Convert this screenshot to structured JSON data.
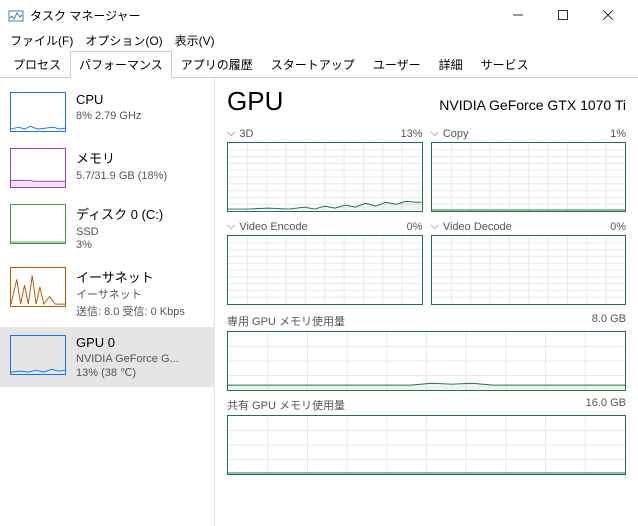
{
  "window": {
    "title": "タスク マネージャー"
  },
  "menu": {
    "file": "ファイル(F)",
    "options": "オプション(O)",
    "view": "表示(V)"
  },
  "tabs": {
    "processes": "プロセス",
    "performance": "パフォーマンス",
    "appHistory": "アプリの履歴",
    "startup": "スタートアップ",
    "users": "ユーザー",
    "details": "詳細",
    "services": "サービス"
  },
  "sidebar": {
    "cpu": {
      "title": "CPU",
      "line1": "8%  2.79 GHz"
    },
    "memory": {
      "title": "メモリ",
      "line1": "5.7/31.9 GB (18%)"
    },
    "disk": {
      "title": "ディスク 0 (C:)",
      "line1": "SSD",
      "line2": "3%"
    },
    "ethernet": {
      "title": "イーサネット",
      "line1": "イーサネット",
      "line2": "送信: 8.0 受信: 0 Kbps"
    },
    "gpu": {
      "title": "GPU 0",
      "line1": "NVIDIA GeForce G...",
      "line2": "13%  (38 ℃)"
    }
  },
  "main": {
    "heading": "GPU",
    "model": "NVIDIA GeForce GTX 1070 Ti",
    "charts": {
      "c3d": {
        "name": "3D",
        "value": "13%"
      },
      "copy": {
        "name": "Copy",
        "value": "1%"
      },
      "vencode": {
        "name": "Video Encode",
        "value": "0%"
      },
      "vdecode": {
        "name": "Video Decode",
        "value": "0%"
      }
    },
    "dedicated": {
      "label": "専用 GPU メモリ使用量",
      "max": "8.0 GB"
    },
    "shared": {
      "label": "共有 GPU メモリ使用量",
      "max": "16.0 GB"
    }
  },
  "chart_data": [
    {
      "type": "line",
      "title": "3D",
      "ylim": [
        0,
        100
      ],
      "values": [
        2,
        2,
        2,
        3,
        2,
        4,
        3,
        5,
        3,
        6,
        4,
        3,
        5,
        4,
        8,
        5,
        10,
        6,
        9,
        12,
        8,
        10,
        9,
        11,
        13
      ]
    },
    {
      "type": "line",
      "title": "Copy",
      "ylim": [
        0,
        100
      ],
      "values": [
        0,
        0,
        0,
        0,
        0,
        0,
        0,
        0,
        0,
        0,
        0,
        0,
        0,
        0,
        0,
        0,
        0,
        0,
        0,
        0,
        0,
        0,
        0,
        0,
        1
      ]
    },
    {
      "type": "line",
      "title": "Video Encode",
      "ylim": [
        0,
        100
      ],
      "values": [
        0,
        0,
        0,
        0,
        0,
        0,
        0,
        0,
        0,
        0,
        0,
        0,
        0,
        0,
        0,
        0,
        0,
        0,
        0,
        0,
        0,
        0,
        0,
        0,
        0
      ]
    },
    {
      "type": "line",
      "title": "Video Decode",
      "ylim": [
        0,
        100
      ],
      "values": [
        0,
        0,
        0,
        0,
        0,
        0,
        0,
        0,
        0,
        0,
        0,
        0,
        0,
        0,
        0,
        0,
        0,
        0,
        0,
        0,
        0,
        0,
        0,
        0,
        0
      ]
    },
    {
      "type": "line",
      "title": "専用 GPU メモリ使用量",
      "ylim": [
        0,
        8.0
      ],
      "values": [
        0.7,
        0.7,
        0.7,
        0.7,
        0.7,
        0.7,
        0.7,
        0.7,
        0.7,
        0.7,
        0.7,
        0.7,
        0.7,
        0.8,
        0.9,
        0.8,
        0.8,
        0.7,
        0.7,
        0.7,
        0.7,
        0.7,
        0.7,
        0.7,
        0.7
      ]
    },
    {
      "type": "line",
      "title": "共有 GPU メモリ使用量",
      "ylim": [
        0,
        16.0
      ],
      "values": [
        0.1,
        0.1,
        0.1,
        0.1,
        0.1,
        0.1,
        0.1,
        0.1,
        0.1,
        0.1,
        0.1,
        0.1,
        0.1,
        0.1,
        0.1,
        0.1,
        0.1,
        0.1,
        0.1,
        0.1,
        0.1,
        0.1,
        0.1,
        0.1,
        0.1
      ]
    }
  ]
}
